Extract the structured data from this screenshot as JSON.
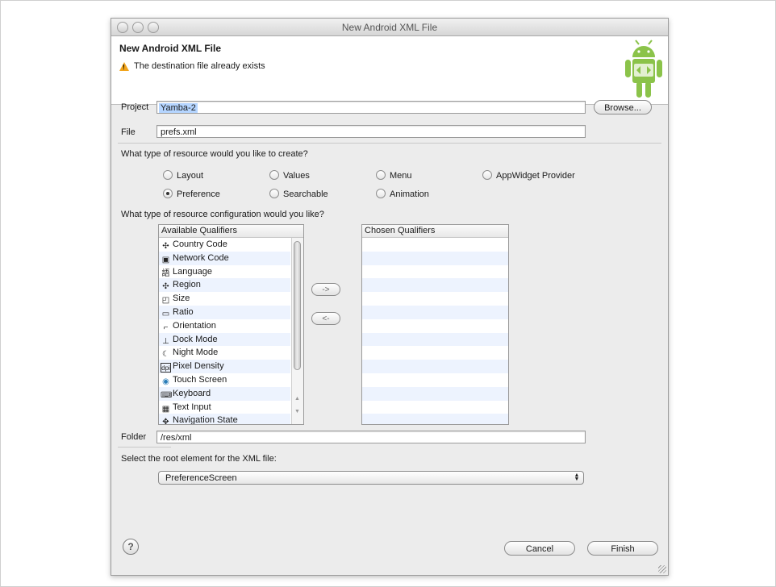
{
  "window": {
    "title": "New Android XML File"
  },
  "header": {
    "title": "New Android XML File",
    "message": "The destination file already exists"
  },
  "project": {
    "label": "Project",
    "value": "Yamba-2",
    "browse_label": "Browse..."
  },
  "file": {
    "label": "File",
    "value": "prefs.xml"
  },
  "resource_type": {
    "question": "What type of resource would you like to create?",
    "options": [
      "Layout",
      "Values",
      "Menu",
      "AppWidget Provider",
      "Preference",
      "Searchable",
      "Animation"
    ],
    "selected": "Preference"
  },
  "configuration": {
    "question": "What type of resource configuration would you like?",
    "available_header": "Available Qualifiers",
    "available": [
      {
        "label": "Country Code",
        "icon": "country-code-icon"
      },
      {
        "label": "Network Code",
        "icon": "network-code-icon"
      },
      {
        "label": "Language",
        "icon": "language-icon"
      },
      {
        "label": "Region",
        "icon": "region-icon"
      },
      {
        "label": "Size",
        "icon": "size-icon"
      },
      {
        "label": "Ratio",
        "icon": "ratio-icon"
      },
      {
        "label": "Orientation",
        "icon": "orientation-icon"
      },
      {
        "label": "Dock Mode",
        "icon": "dock-mode-icon"
      },
      {
        "label": "Night Mode",
        "icon": "night-mode-icon"
      },
      {
        "label": "Pixel Density",
        "icon": "pixel-density-icon"
      },
      {
        "label": "Touch Screen",
        "icon": "touch-screen-icon"
      },
      {
        "label": "Keyboard",
        "icon": "keyboard-icon"
      },
      {
        "label": "Text Input",
        "icon": "text-input-icon"
      },
      {
        "label": "Navigation State",
        "icon": "navigation-state-icon"
      }
    ],
    "add_label": "->",
    "remove_label": "<-",
    "chosen_header": "Chosen Qualifiers"
  },
  "folder": {
    "label": "Folder",
    "value": "/res/xml"
  },
  "root_element": {
    "question": "Select the root element for the XML file:",
    "value": "PreferenceScreen"
  },
  "buttons": {
    "help": "?",
    "cancel": "Cancel",
    "finish": "Finish"
  }
}
